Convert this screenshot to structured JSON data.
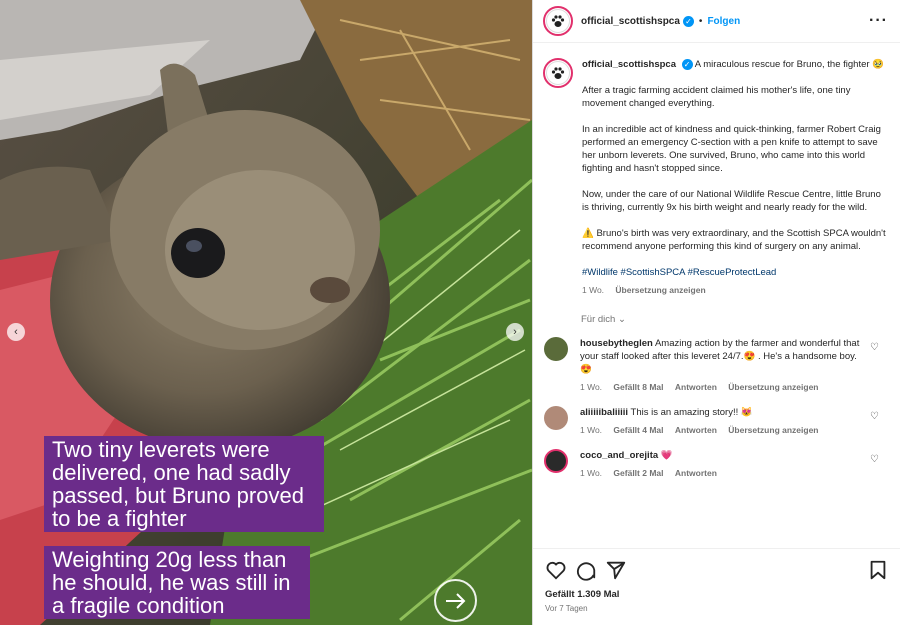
{
  "media": {
    "caption_1": "Two tiny leverets were\ndelivered, one had sadly\npassed, but Bruno proved\nto be a fighter",
    "caption_2": "Weighting 20g less than\nhe should, he was still in\na fragile condition",
    "prev_arrow": "‹",
    "next_arrow": "›"
  },
  "header": {
    "username": "official_scottishspca",
    "verified_icon": "✓",
    "separator": "•",
    "follow_label": "Folgen",
    "more_label": "···"
  },
  "post": {
    "username": "official_scottishspca",
    "headline": "A miraculous rescue for Bruno, the fighter 🥹",
    "paragraphs": [
      "After a tragic farming accident claimed his mother's life, one tiny movement changed everything.",
      "In an incredible act of kindness and quick-thinking, farmer Robert Craig performed an emergency C-section with a pen knife to attempt to save her unborn leverets. One survived, Bruno, who came into this world fighting and hasn't stopped since.",
      "Now, under the care of our National Wildlife Rescue Centre, little Bruno is thriving, currently 9x his birth weight and nearly ready for the wild.",
      "⚠️ Bruno's birth was very extraordinary, and the Scottish SPCA wouldn't recommend anyone performing this kind of surgery on any animal."
    ],
    "hashtags": "#Wildlife #ScottishSPCA #RescueProtectLead",
    "age": "1 Wo.",
    "translate": "Übersetzung anzeigen"
  },
  "for_you": "Für dich ⌄",
  "comments": [
    {
      "username": "housebytheglen",
      "text": "Amazing action by the farmer and wonderful that your staff looked after this leveret 24/7.😍 . He's a handsome boy.😍",
      "age": "1 Wo.",
      "likes": "Gefällt 8 Mal",
      "reply": "Antworten",
      "translate": "Übersetzung anzeigen",
      "avatar_color": "#5a6b3a"
    },
    {
      "username": "aliiiiibaliiiii",
      "text": "This is an amazing story!! 😻",
      "age": "1 Wo.",
      "likes": "Gefällt 4 Mal",
      "reply": "Antworten",
      "translate": "Übersetzung anzeigen",
      "avatar_color": "#b08a78"
    },
    {
      "username": "coco_and_orejita",
      "text": "💗",
      "age": "1 Wo.",
      "likes": "Gefällt 2 Mal",
      "reply": "Antworten",
      "avatar_color": "#2a2a2a"
    }
  ],
  "footer": {
    "likes": "Gefällt 1.309 Mal",
    "time": "Vor 7 Tagen"
  },
  "colors": {
    "caption_bg": "#6b2c8a",
    "link": "#0095f6",
    "hashtag": "#00376b",
    "muted": "#737373"
  }
}
